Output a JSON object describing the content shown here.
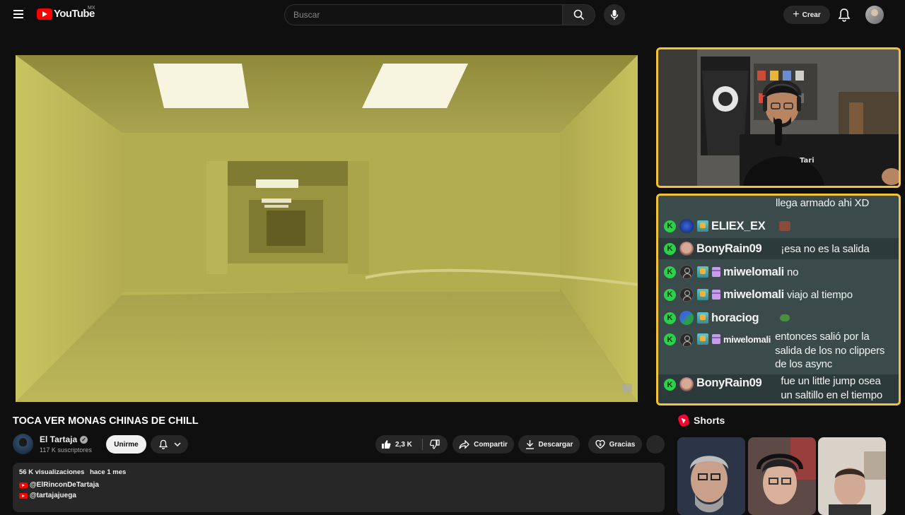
{
  "header": {
    "logo_word": "YouTube",
    "region": "MX",
    "search_placeholder": "Buscar",
    "create_label": "Crear",
    "icons": [
      "menu-icon",
      "search-icon",
      "mic-icon",
      "plus-icon",
      "bell-icon"
    ]
  },
  "video": {
    "title": "TOCA VER MONAS CHINAS DE CHILL",
    "channel_name": "El Tartaja",
    "subscribers": "117 K suscriptores",
    "join_label": "Unirme",
    "likes": "2,3 K",
    "share_label": "Compartir",
    "download_label": "Descargar",
    "thanks_label": "Gracias"
  },
  "description": {
    "views": "56 K visualizaciones",
    "date": "hace 1 mes",
    "links": [
      "@ElRinconDeTartaja",
      "@tartajajuega"
    ]
  },
  "chat": {
    "messages": [
      {
        "user": "",
        "text": "llega armado ahi XD"
      },
      {
        "user": "ELIEX_EX",
        "text": ""
      },
      {
        "user": "BonyRain09",
        "text": "¡esa no es la salida"
      },
      {
        "user": "miwelomali",
        "text": "no"
      },
      {
        "user": "miwelomali",
        "text": "viajo al tiempo"
      },
      {
        "user": "horaciog",
        "text": ""
      },
      {
        "user": "miwelomali",
        "text": "entonces salió por la",
        "text2": "salida de los no clippers",
        "text3": "de los async"
      },
      {
        "user": "BonyRain09",
        "text": "fue un little jump osea",
        "text2": "un saltillo en el tiempo"
      }
    ]
  },
  "shorts": {
    "heading": "Shorts"
  },
  "colors": {
    "accent": "#ff0000",
    "overlay_border": "#f4c237",
    "chat_bg": "#3b4a4a",
    "kick_green": "#2ad24a"
  }
}
